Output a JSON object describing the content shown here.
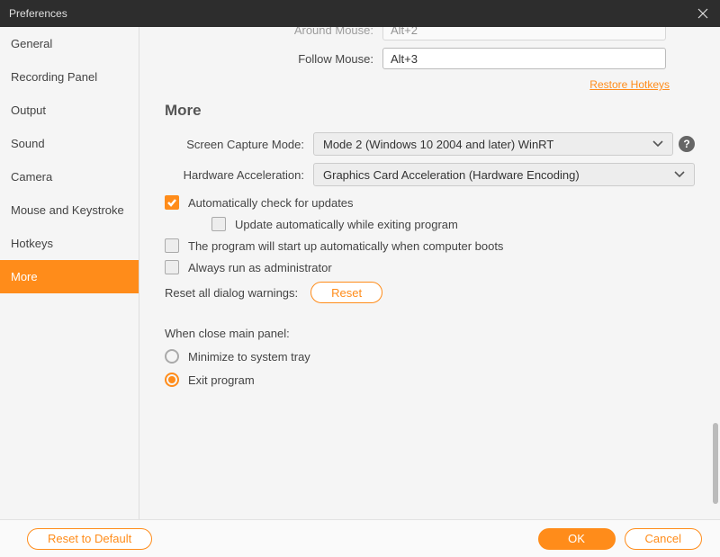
{
  "window": {
    "title": "Preferences"
  },
  "sidebar": {
    "items": [
      {
        "label": "General"
      },
      {
        "label": "Recording Panel"
      },
      {
        "label": "Output"
      },
      {
        "label": "Sound"
      },
      {
        "label": "Camera"
      },
      {
        "label": "Mouse and Keystroke"
      },
      {
        "label": "Hotkeys"
      },
      {
        "label": "More",
        "active": true
      }
    ]
  },
  "topfields": {
    "around_mouse": {
      "label": "Around Mouse:",
      "value": "Alt+2"
    },
    "follow_mouse": {
      "label": "Follow Mouse:",
      "value": "Alt+3"
    }
  },
  "restore_hotkeys": "Restore Hotkeys",
  "more": {
    "heading": "More",
    "screen_capture": {
      "label": "Screen Capture Mode:",
      "value": "Mode 2 (Windows 10 2004 and later) WinRT"
    },
    "hw_accel": {
      "label": "Hardware Acceleration:",
      "value": "Graphics Card Acceleration (Hardware Encoding)"
    },
    "check_updates": "Automatically check for updates",
    "update_auto_exit": "Update automatically while exiting program",
    "startup_boot": "The program will start up automatically when computer boots",
    "run_admin": "Always run as administrator",
    "reset_dialogs_label": "Reset all dialog warnings:",
    "reset_button": "Reset",
    "close_panel": {
      "heading": "When close main panel:",
      "minimize": "Minimize to system tray",
      "exit": "Exit program"
    }
  },
  "footer": {
    "reset_default": "Reset to Default",
    "ok": "OK",
    "cancel": "Cancel"
  }
}
